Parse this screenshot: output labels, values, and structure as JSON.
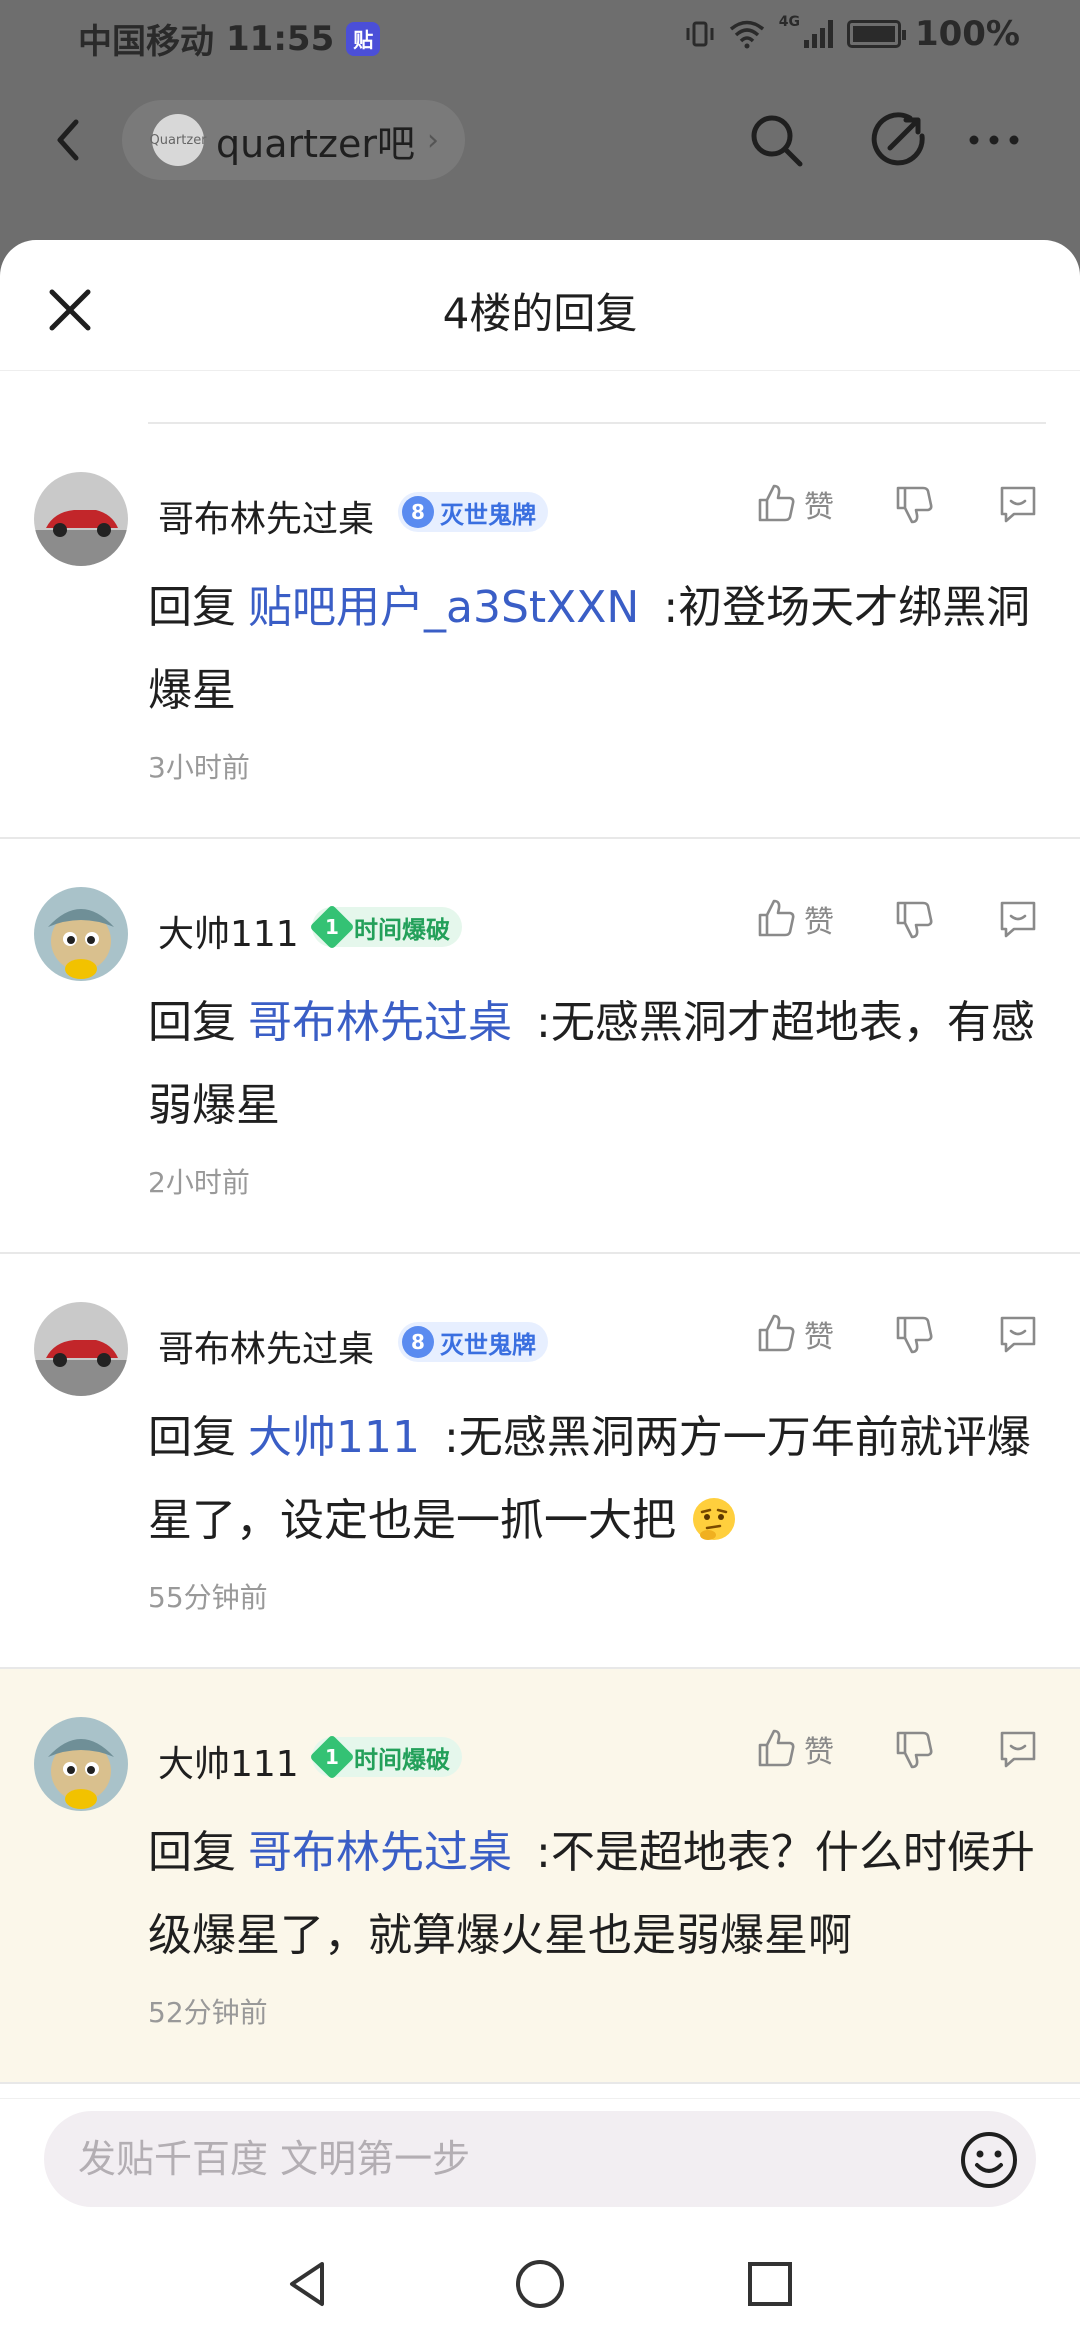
{
  "status_bar": {
    "carrier": "中国移动",
    "time": "11:55",
    "app_badge": "贴",
    "network": "4G",
    "battery": "100%"
  },
  "top_nav": {
    "forum_logo": "Quartzer",
    "forum_name": "quartzer吧",
    "chevron": "›"
  },
  "sheet": {
    "title": "4楼的回复"
  },
  "replies": [
    {
      "username": "哥布林先过桌",
      "badge_level": "8",
      "badge_name": "灭世鬼牌",
      "like_label": "赞",
      "prefix": "回复",
      "mention": "贴吧用户_a3StXXN",
      "text": ":初登场天才绑黑洞爆星",
      "time": "3小时前"
    },
    {
      "username": "大帅111",
      "badge_level": "1",
      "badge_name": "时间爆破",
      "like_label": "赞",
      "prefix": "回复",
      "mention": "哥布林先过桌",
      "text": ":无感黑洞才超地表，有感弱爆星",
      "time": "2小时前"
    },
    {
      "username": "哥布林先过桌",
      "badge_level": "8",
      "badge_name": "灭世鬼牌",
      "like_label": "赞",
      "prefix": "回复",
      "mention": "大帅111",
      "text": ":无感黑洞两方一万年前就评爆星了，设定也是一抓一大把",
      "time": "55分钟前"
    },
    {
      "username": "大帅111",
      "badge_level": "1",
      "badge_name": "时间爆破",
      "like_label": "赞",
      "prefix": "回复",
      "mention": "哥布林先过桌",
      "text": ":不是超地表？什么时候升级爆星了，就算爆火星也是弱爆星啊",
      "time": "52分钟前"
    }
  ],
  "composer": {
    "placeholder": "发贴千百度 文明第一步"
  },
  "colors": {
    "mention": "#3a5ec6",
    "highlight_bg": "#fbf7ea",
    "badge_blue": "#5a8bf0",
    "badge_green": "#34c274"
  },
  "icons": [
    "back-icon",
    "search-icon",
    "share-icon",
    "more-icon",
    "close-icon",
    "like-icon",
    "dislike-icon",
    "comment-icon",
    "thinking-emoji-icon",
    "emoji-icon",
    "back-triangle-icon",
    "home-circle-icon",
    "recents-square-icon"
  ]
}
